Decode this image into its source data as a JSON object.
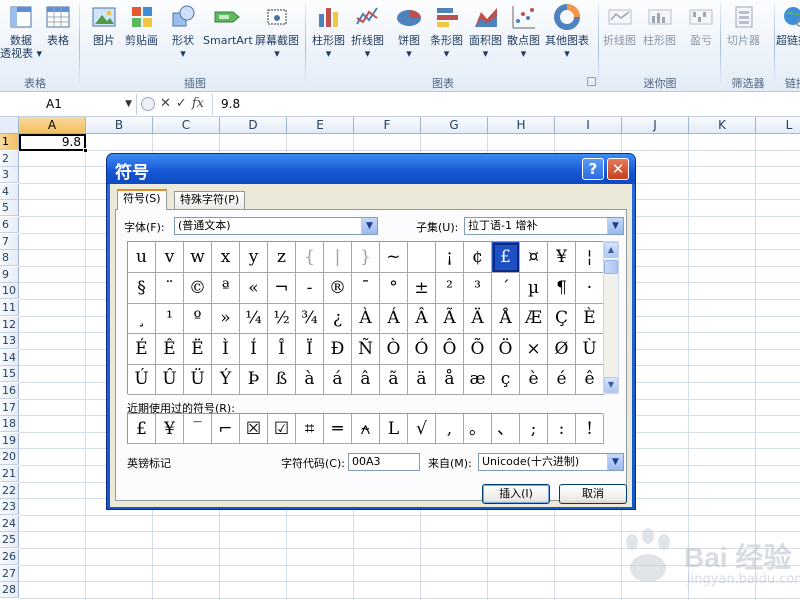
{
  "ribbon": {
    "groups": [
      {
        "label": "表格"
      },
      {
        "label": "插图"
      },
      {
        "label": "图表"
      },
      {
        "label": "迷你图"
      },
      {
        "label": "筛选器"
      },
      {
        "label": "链接"
      }
    ],
    "buttons": {
      "pivot": {
        "label": "数据",
        "sub": "透视表 ▾"
      },
      "table": {
        "label": "表格"
      },
      "picture": {
        "label": "图片"
      },
      "clipart": {
        "label": "剪贴画"
      },
      "shapes": {
        "label": "形状",
        "sub": "▾"
      },
      "smartart": {
        "label": "SmartArt"
      },
      "screenshot": {
        "label": "屏幕截图",
        "sub": "▾"
      },
      "column": {
        "label": "柱形图",
        "sub": "▾"
      },
      "line": {
        "label": "折线图",
        "sub": "▾"
      },
      "pie": {
        "label": "饼图",
        "sub": "▾"
      },
      "bar": {
        "label": "条形图",
        "sub": "▾"
      },
      "area": {
        "label": "面积图",
        "sub": "▾"
      },
      "scatter": {
        "label": "散点图",
        "sub": "▾"
      },
      "other": {
        "label": "其他图表",
        "sub": "▾"
      },
      "spark_line": {
        "label": "折线图"
      },
      "spark_column": {
        "label": "柱形图"
      },
      "spark_winloss": {
        "label": "盈亏"
      },
      "slicer": {
        "label": "切片器"
      },
      "hyperlink": {
        "label": "超链接"
      }
    }
  },
  "formula_bar": {
    "name_box": "A1",
    "fx": "fx",
    "value": "9.8"
  },
  "sheet": {
    "columns": [
      "A",
      "B",
      "C",
      "D",
      "E",
      "F",
      "G",
      "H",
      "I",
      "J",
      "K",
      "L"
    ],
    "rows": [
      "1",
      "2",
      "3",
      "4",
      "5",
      "6",
      "7",
      "8",
      "9",
      "10",
      "11",
      "12",
      "13",
      "14",
      "15",
      "16",
      "17",
      "18",
      "19",
      "20",
      "21",
      "22",
      "23",
      "24",
      "25",
      "26",
      "27",
      "28"
    ],
    "a1_value": "9.8"
  },
  "dialog": {
    "title": "符号",
    "help": "?",
    "close": "✕",
    "tabs": [
      "符号(S)",
      "特殊字符(P)"
    ],
    "font_label": "字体(F):",
    "font_value": "(普通文本)",
    "subset_label": "子集(U):",
    "subset_value": "拉丁语-1 增补",
    "symbols": [
      [
        "u",
        "v",
        "w",
        "x",
        "y",
        "z",
        "{",
        "|",
        "}",
        "~",
        "",
        "¡",
        "¢",
        "£",
        "¤",
        "¥",
        "¦"
      ],
      [
        "§",
        "¨",
        "©",
        "ª",
        "«",
        "¬",
        "-",
        "®",
        "¯",
        "°",
        "±",
        "²",
        "³",
        "´",
        "µ",
        "¶",
        "·"
      ],
      [
        "¸",
        "¹",
        "º",
        "»",
        "¼",
        "½",
        "¾",
        "¿",
        "À",
        "Á",
        "Â",
        "Ã",
        "Ä",
        "Å",
        "Æ",
        "Ç",
        "È"
      ],
      [
        "É",
        "Ê",
        "Ë",
        "Ì",
        "Í",
        "Î",
        "Ï",
        "Ð",
        "Ñ",
        "Ò",
        "Ó",
        "Ô",
        "Õ",
        "Ö",
        "×",
        "Ø",
        "Ù"
      ],
      [
        "Ú",
        "Û",
        "Ü",
        "Ý",
        "Þ",
        "ß",
        "à",
        "á",
        "â",
        "ã",
        "ä",
        "å",
        "æ",
        "ç",
        "è",
        "é",
        "ê"
      ]
    ],
    "recent_label": "近期使用过的符号(R):",
    "recent": [
      "£",
      "¥",
      "‾",
      "⌐",
      "☒",
      "☑",
      "⌗",
      "═",
      "⍲",
      "L",
      "√",
      ",",
      "。",
      "、",
      ";",
      ":",
      "!"
    ],
    "char_name": "英镑标记",
    "code_label": "字符代码(C):",
    "code_value": "00A3",
    "from_label": "来自(M):",
    "from_value": "Unicode(十六进制)",
    "insert": "插入(I)",
    "cancel": "取消"
  },
  "watermark": {
    "brand": "Bai 经验",
    "url": "jingyan.baidu.com"
  },
  "colors": {
    "selection": "#1f51c4",
    "title_bar": "#1556d4",
    "dialog_face": "#ece9d8"
  }
}
